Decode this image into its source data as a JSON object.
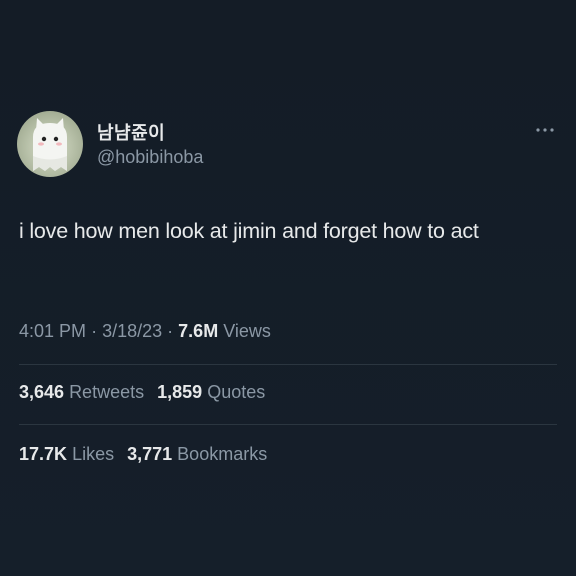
{
  "colors": {
    "background": "#15202b",
    "text_primary": "#e7e9ea",
    "text_secondary": "#8b98a5",
    "divider": "#2b3640"
  },
  "author": {
    "display_name": "남냠쥰이",
    "handle": "@hobibihoba",
    "avatar_icon": "ghost-cat-avatar"
  },
  "more_icon": "more-horizontal-icon",
  "tweet": {
    "text": "i love how men look at jimin and forget how to act"
  },
  "meta": {
    "time": "4:01 PM",
    "separator": "·",
    "date": "3/18/23",
    "views_count": "7.6M",
    "views_label": "Views"
  },
  "stats_row1": [
    {
      "count": "3,646",
      "label": "Retweets"
    },
    {
      "count": "1,859",
      "label": "Quotes"
    }
  ],
  "stats_row2": [
    {
      "count": "17.7K",
      "label": "Likes"
    },
    {
      "count": "3,771",
      "label": "Bookmarks"
    }
  ]
}
